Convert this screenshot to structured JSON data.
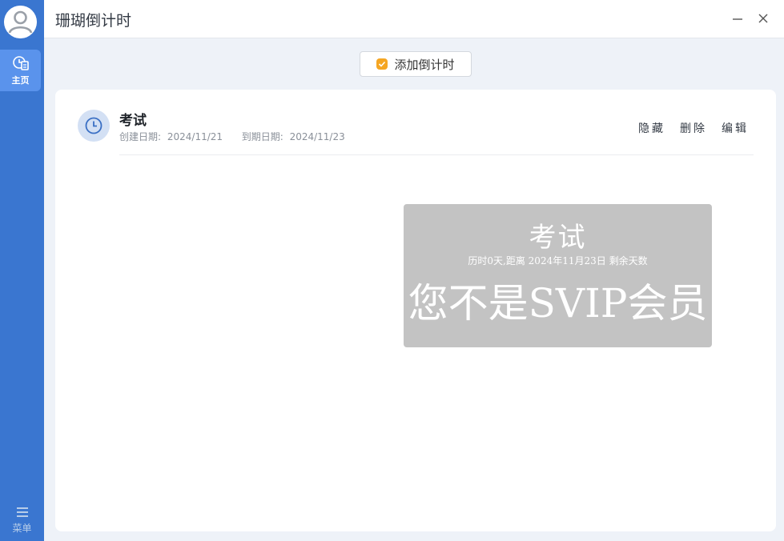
{
  "app": {
    "title": "珊瑚倒计时"
  },
  "sidebar": {
    "home_label": "主页",
    "menu_label": "菜单"
  },
  "toolbar": {
    "add_label": "添加倒计时"
  },
  "event": {
    "title": "考试",
    "created_label": "创建日期:",
    "created_value": "2024/11/21",
    "due_label": "到期日期:",
    "due_value": "2024/11/23",
    "actions": {
      "hide": "隐藏",
      "delete": "删除",
      "edit": "编辑"
    }
  },
  "preview": {
    "title": "考试",
    "subtitle": "历时0天,距离 2024年11月23日 剩余天数",
    "warning": "您不是SVIP会员"
  },
  "colors": {
    "sidebar": "#3a76d0",
    "sidebar_active": "#5a93ec",
    "accent_badge": "#f5a623",
    "preview_bg": "#c3c3c3"
  }
}
